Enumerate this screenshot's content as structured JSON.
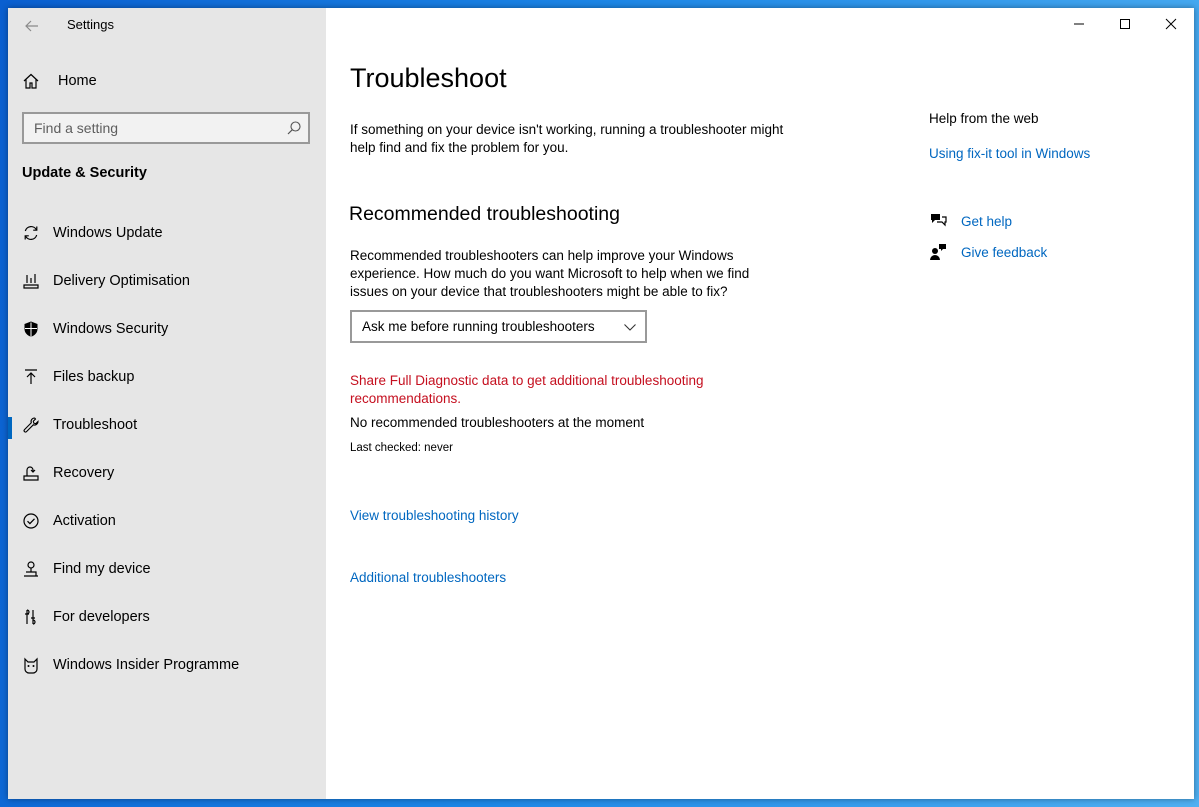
{
  "window": {
    "title": "Settings"
  },
  "sidebar": {
    "home_label": "Home",
    "search_placeholder": "Find a setting",
    "section_heading": "Update & Security",
    "items": [
      {
        "label": "Windows Update",
        "icon": "sync-icon"
      },
      {
        "label": "Delivery Optimisation",
        "icon": "delivery-optimisation-icon"
      },
      {
        "label": "Windows Security",
        "icon": "shield-icon"
      },
      {
        "label": "Files backup",
        "icon": "backup-arrow-icon"
      },
      {
        "label": "Troubleshoot",
        "icon": "wrench-icon",
        "selected": true
      },
      {
        "label": "Recovery",
        "icon": "recovery-icon"
      },
      {
        "label": "Activation",
        "icon": "check-circle-icon"
      },
      {
        "label": "Find my device",
        "icon": "find-device-icon"
      },
      {
        "label": "For developers",
        "icon": "developer-tools-icon"
      },
      {
        "label": "Windows Insider Programme",
        "icon": "insider-cat-icon"
      }
    ]
  },
  "main": {
    "title": "Troubleshoot",
    "intro": "If something on your device isn't working, running a troubleshooter might help find and fix the problem for you.",
    "recommended": {
      "heading": "Recommended troubleshooting",
      "description": "Recommended troubleshooters can help improve your Windows experience. How much do you want Microsoft to help when we find issues on your device that troubleshooters might be able to fix?",
      "dropdown_value": "Ask me before running troubleshooters",
      "diagnostic_link": "Share Full Diagnostic data to get additional troubleshooting recommendations.",
      "status": "No recommended troubleshooters at the moment",
      "last_checked": "Last checked: never"
    },
    "history_link": "View troubleshooting history",
    "additional_link": "Additional troubleshooters"
  },
  "help": {
    "title": "Help from the web",
    "fixit_link": "Using fix-it tool in Windows",
    "get_help": "Get help",
    "give_feedback": "Give feedback"
  },
  "colors": {
    "accent": "#0067c0",
    "warning_link": "#c50f1f",
    "sidebar_bg": "#e6e6e6"
  }
}
